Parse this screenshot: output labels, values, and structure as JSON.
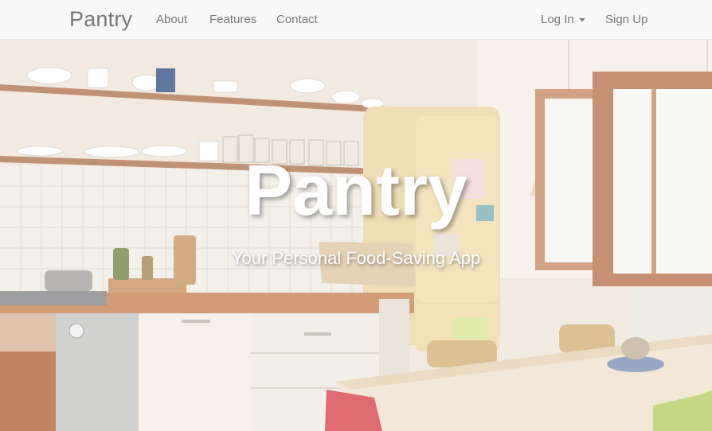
{
  "navbar": {
    "brand": "Pantry",
    "links": {
      "about": "About",
      "features": "Features",
      "contact": "Contact"
    },
    "login": "Log In",
    "signup": "Sign Up"
  },
  "hero": {
    "title": "Pantry",
    "subtitle": "Your Personal Food-Saving App"
  },
  "colors": {
    "navbar_bg": "#f8f8f8",
    "nav_text": "#777777",
    "hero_text": "#ffffff"
  }
}
